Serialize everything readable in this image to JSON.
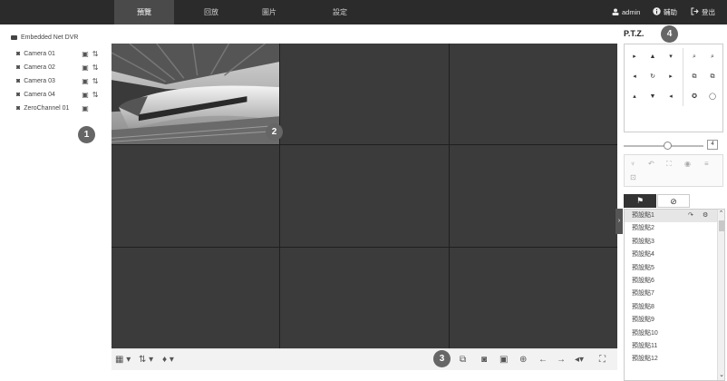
{
  "topbar": {
    "tabs": [
      "預覽",
      "回放",
      "圖片",
      "設定"
    ],
    "active_tab": 0,
    "user": "admin",
    "help": "輔助",
    "logout": "登出"
  },
  "device_tree": {
    "root": "Embedded Net DVR",
    "cameras": [
      "Camera 01",
      "Camera 02",
      "Camera 03",
      "Camera 04",
      "ZeroChannel 01"
    ]
  },
  "callouts": [
    "1",
    "2",
    "3",
    "4"
  ],
  "ptz": {
    "title": "P.T.Z.",
    "speed_value": "4",
    "tabs_active_icon": "flag-icon",
    "tabs_inactive_icon": "route-icon",
    "presets": [
      "預設點1",
      "預設點2",
      "預設點3",
      "預設點4",
      "預設點5",
      "預設點6",
      "預設點7",
      "預設點8",
      "預設點9",
      "預設點10",
      "預設點11",
      "預設點12"
    ]
  },
  "colors": {
    "topbar": "#2b2b2b",
    "grid_cell": "#3b3b3b",
    "callout": "#666666"
  }
}
